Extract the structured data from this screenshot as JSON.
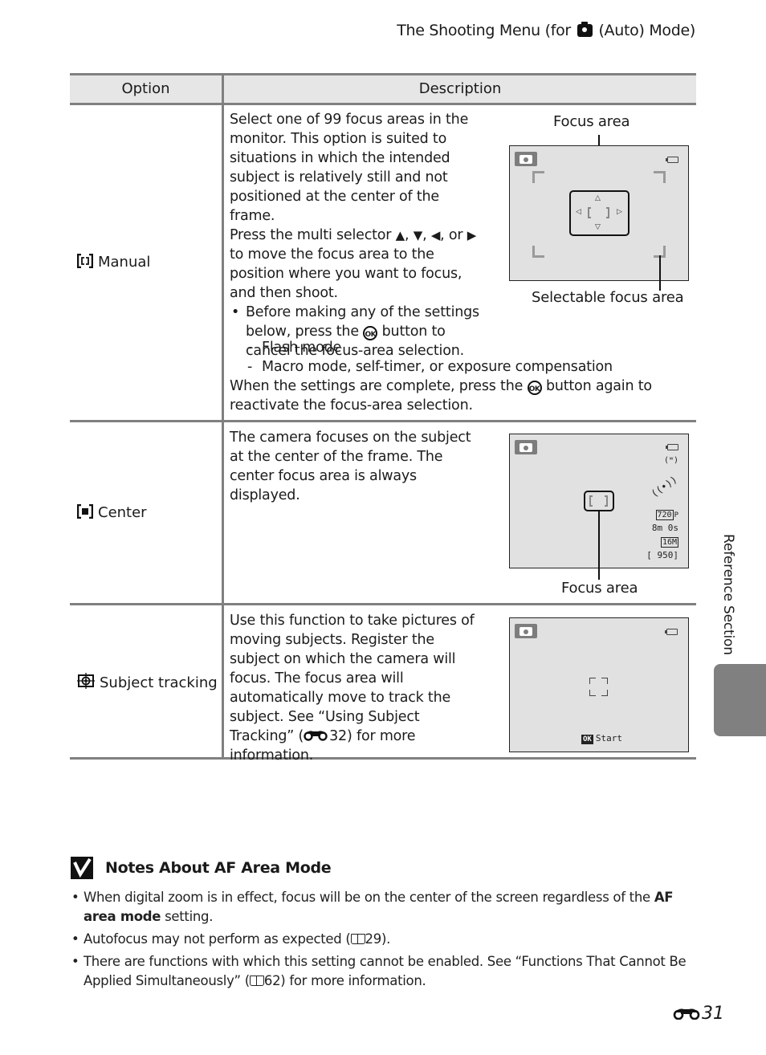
{
  "header": {
    "running_head_prefix": "The Shooting Menu (for",
    "running_head_icon": "camera-auto-icon",
    "running_head_suffix": "(Auto) Mode)"
  },
  "table": {
    "columns": [
      "Option",
      "Description"
    ],
    "rows": [
      {
        "option_icon": "manual-focus-area-icon",
        "option": "Manual",
        "description": {
          "intro": "Select one of 99 focus areas in the monitor. This option is suited to situations in which the intended subject is relatively still and not positioned at the center of the frame.",
          "press_prefix": "Press the multi selector",
          "arrows": [
            "▲",
            "▼",
            "◀",
            "▶"
          ],
          "press_or": ", or",
          "press_suffix": "to move the focus area to the position where you want to focus, and then shoot.",
          "bullet_prefix": "Before making any of the settings below, press the",
          "bullet_ok": "OK",
          "bullet_suffix": "button to cancel the focus-area selection.",
          "sub_items": [
            "Flash mode",
            "Macro mode, self-timer, or exposure compensation"
          ],
          "outro_prefix": "When the settings are complete, press the",
          "outro_ok": "OK",
          "outro_suffix": "button again to reactivate the focus-area selection."
        },
        "figure": {
          "callout_top": "Focus area",
          "callout_bottom": "Selectable focus area"
        }
      },
      {
        "option_icon": "center-focus-area-icon",
        "option": "Center",
        "description": {
          "text": "The camera focuses on the subject at the center of the frame. The center focus area is always displayed."
        },
        "figure": {
          "callout_bottom": "Focus area",
          "indicators": {
            "movie_size": "720",
            "movie_suffix": "P",
            "remaining_time": "8m 0s",
            "image_size": "16M",
            "exposures_remaining": "[ 950]"
          }
        }
      },
      {
        "option_icon": "subject-tracking-icon",
        "option": "Subject tracking",
        "description": {
          "text_before_ref": "Use this function to take pictures of moving subjects. Register the subject on which the camera will focus. The focus area will automatically move to track the subject. See “Using Subject Tracking” (",
          "ref_icon": "reference-section-icon",
          "ref_page": "32",
          "text_after_ref": ") for more information."
        },
        "figure": {
          "ok_badge": "OK",
          "ok_label": "Start"
        }
      }
    ]
  },
  "notes": {
    "title": "Notes About AF Area Mode",
    "title_icon": "check-icon",
    "items": [
      {
        "before": "When digital zoom is in effect, focus will be on the center of the screen regardless of the ",
        "bold": "AF area mode",
        "after": " setting."
      },
      {
        "before": "Autofocus may not perform as expected (",
        "ref_icon": "book-icon",
        "ref_page": "29",
        "after": ")."
      },
      {
        "before": "There are functions with which this setting cannot be enabled. See “Functions That Cannot Be Applied Simultaneously” (",
        "ref_icon": "book-icon",
        "ref_page": "62",
        "after": ") for more information."
      }
    ]
  },
  "side_tab": {
    "label": "Reference Section",
    "color": "#808080"
  },
  "footer": {
    "page_icon": "reference-section-icon",
    "page_number": "31"
  },
  "colors": {
    "rule": "#808080",
    "header_fill": "#e6e6e6",
    "screen_fill": "#e1e1e1"
  }
}
